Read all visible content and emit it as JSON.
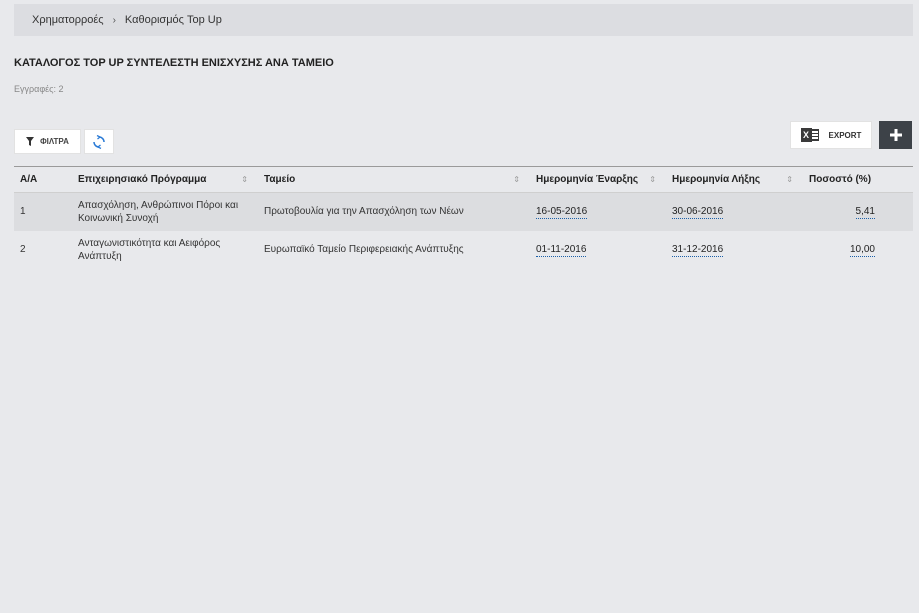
{
  "breadcrumb": {
    "item1": "Χρηματορροές",
    "separator": "›",
    "item2": "Καθορισμός Top Up"
  },
  "page_title": "ΚΑΤΑΛΟΓΟΣ TOP UP ΣΥΝΤΕΛΕΣΤΗ ΕΝΙΣΧΥΣΗΣ ΑΝΑ ΤΑΜΕΙΟ",
  "record_count": "Εγγραφές: 2",
  "toolbar": {
    "filter_label": "ΦΙΛΤΡΑ",
    "export_label": "EXPORT"
  },
  "icons": {
    "filter": "filter-funnel-icon",
    "refresh": "refresh-icon",
    "export": "excel-icon",
    "add": "plus-icon",
    "sort": "sort-arrows-icon"
  },
  "colors": {
    "link_underline": "#1a5fa8",
    "add_button": "#3d4248"
  },
  "table": {
    "headers": {
      "aa": "Α/Α",
      "program": "Επιχειρησιακό Πρόγραμμα",
      "fund": "Ταμείο",
      "start": "Ημερομηνία Έναρξης",
      "end": "Ημερομηνία Λήξης",
      "percent": "Ποσοστό (%)"
    },
    "rows": [
      {
        "aa": "1",
        "program": "Απασχόληση, Ανθρώπινοι Πόροι και Κοινωνική Συνοχή",
        "fund": "Πρωτοβουλία για την Απασχόληση των Νέων",
        "start": "16-05-2016",
        "end": "30-06-2016",
        "percent": "5,41"
      },
      {
        "aa": "2",
        "program": "Ανταγωνιστικότητα και Αειφόρος Ανάπτυξη",
        "fund": "Ευρωπαϊκό Ταμείο Περιφερειακής Ανάπτυξης",
        "start": "01-11-2016",
        "end": "31-12-2016",
        "percent": "10,00"
      }
    ]
  }
}
